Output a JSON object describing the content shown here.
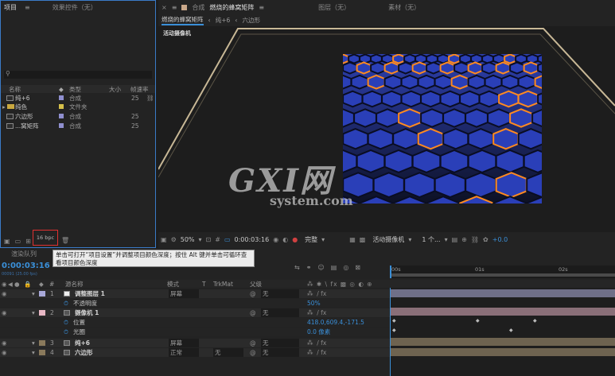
{
  "project": {
    "tabs": [
      "项目",
      "效果控件（无）"
    ],
    "columns": {
      "name": "名称",
      "type": "类型",
      "size": "大小",
      "fps": "帧速率"
    },
    "items": [
      {
        "name": "纯+6",
        "type": "合成",
        "fps": "25",
        "color": "#8f8fcf",
        "icon": "composition-icon"
      },
      {
        "name": "纯色",
        "type": "文件夹",
        "fps": "",
        "color": "#d6c04a",
        "icon": "folder-icon"
      },
      {
        "name": "六边形",
        "type": "合成",
        "fps": "25",
        "color": "#8f8fcf",
        "icon": "composition-icon"
      },
      {
        "name": "...窝矩阵",
        "type": "合成",
        "fps": "25",
        "color": "#8f8fcf",
        "icon": "composition-icon"
      }
    ],
    "bpc": "16 bpc"
  },
  "viewer": {
    "tab_prefix": "合成",
    "tab_name": "燃烧的蜂窝矩阵",
    "other_tabs": [
      "图层（无）",
      "素材（无）"
    ],
    "breadcrumb": [
      "燃烧的蜂窝矩阵",
      "纯+6",
      "六边形"
    ],
    "camera_label": "活动摄像机",
    "zoom": "50%",
    "timecode": "0:00:03:16",
    "resolution": "完整",
    "camera_select": "活动摄像机",
    "views": "1 个...",
    "exposure": "+0.0"
  },
  "tooltip": "单击可打开“项目设置”并调整项目颜色深度；按住 Alt 键并单击可循环查看项目颜色深度",
  "timeline": {
    "tab": "渲染队列",
    "current_time": "0:00:03:16",
    "current_frames": "00091 (25.00 fps)",
    "headers": {
      "num": "#",
      "name": "源名称",
      "mode": "模式",
      "t": "T",
      "trkmat": "TrkMat",
      "parent": "父级"
    },
    "ruler": [
      "00s",
      "01s",
      "02s"
    ],
    "layers": [
      {
        "num": "1",
        "name": "调整图层 1",
        "mode": "屏幕",
        "trkmat": "",
        "parent": "无",
        "color": "#a8a8d8",
        "bold": true
      },
      {
        "num": "",
        "name": "不透明度",
        "prop": "50%"
      },
      {
        "num": "2",
        "name": "摄像机 1",
        "mode": "",
        "trkmat": "",
        "parent": "无",
        "color": "#e7b7c4",
        "bold": true
      },
      {
        "num": "",
        "name": "位置",
        "prop": "418.0,609.4,-171.5"
      },
      {
        "num": "",
        "name": "光圈",
        "prop": "0.0 像素"
      },
      {
        "num": "3",
        "name": "纯+6",
        "mode": "屏幕",
        "trkmat": "",
        "parent": "无",
        "color": "#8a7a5c",
        "bold": true
      },
      {
        "num": "4",
        "name": "六边形",
        "mode": "正常",
        "trkmat": "无",
        "parent": "无",
        "color": "#8a7a5c",
        "bold": true
      }
    ]
  },
  "watermark": {
    "text": "GXI网",
    "sub": "system.com"
  }
}
